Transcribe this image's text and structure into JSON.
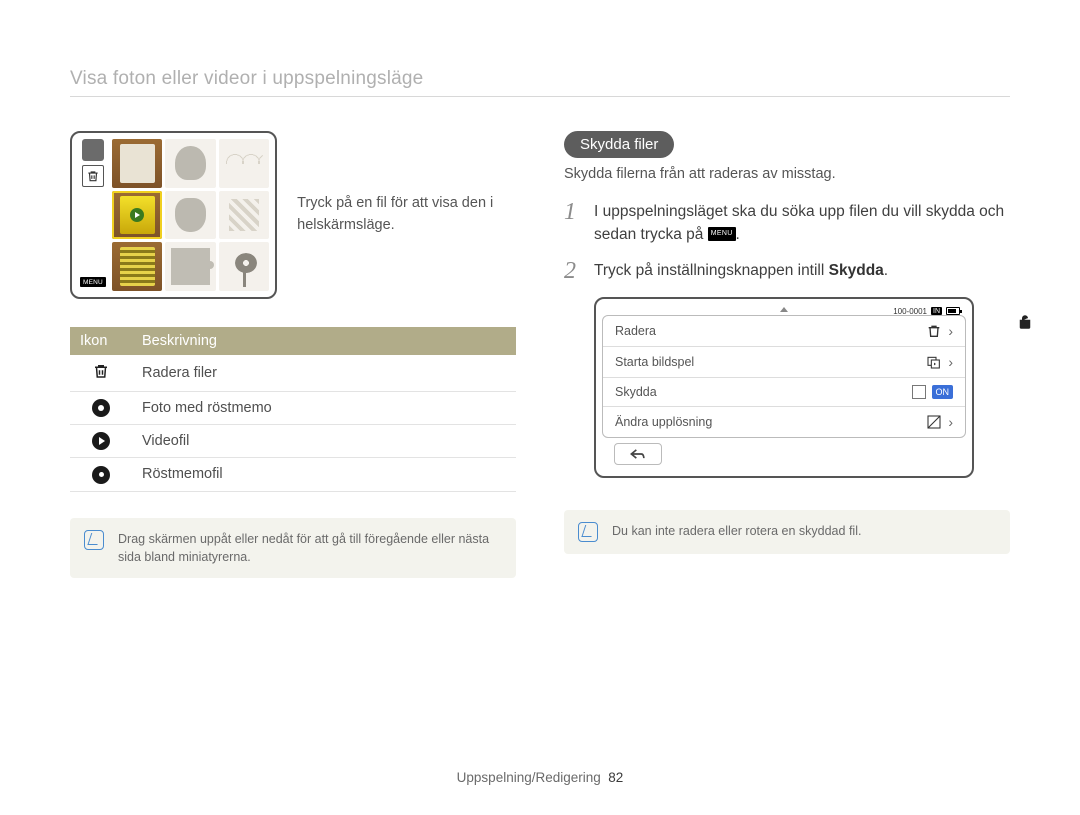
{
  "page_title": "Visa foton eller videor i uppspelningsläge",
  "left": {
    "illustration_caption": "Tryck på en fil för att visa den i helskärmsläge.",
    "menu_label": "MENU",
    "legend_headers": {
      "icon": "Ikon",
      "desc": "Beskrivning"
    },
    "legend": [
      {
        "icon": "trash-icon",
        "desc": "Radera filer"
      },
      {
        "icon": "voice-dot-icon",
        "desc": "Foto med röstmemo"
      },
      {
        "icon": "video-play-icon",
        "desc": "Videofil"
      },
      {
        "icon": "voice-memo-icon",
        "desc": "Röstmemofil"
      }
    ],
    "note": "Drag skärmen uppåt eller nedåt för att gå till föregående eller nästa sida bland miniatyrerna."
  },
  "right": {
    "section_title": "Skydda filer",
    "intro": "Skydda filerna från att raderas av misstag.",
    "steps": [
      {
        "num": "1",
        "text_before": "I uppspelningsläget ska du söka upp filen du vill skydda och sedan trycka på ",
        "chip": "MENU",
        "text_after": "."
      },
      {
        "num": "2",
        "text_before": "Tryck på inställningsknappen intill ",
        "bold": "Skydda",
        "text_after": "."
      }
    ],
    "camera_menu": {
      "status_id": "100-0001",
      "status_mem": "IN",
      "items": [
        {
          "label": "Radera",
          "icon": "trash-icon",
          "action": "chevron"
        },
        {
          "label": "Starta bildspel",
          "icon": "slideshow-icon",
          "action": "chevron"
        },
        {
          "label": "Skydda",
          "icon": null,
          "action": "on",
          "on_label": "ON"
        },
        {
          "label": "Ändra upplösning",
          "icon": "resize-icon",
          "action": "chevron"
        }
      ]
    },
    "note": "Du kan inte radera eller rotera en skyddad fil."
  },
  "footer": {
    "section": "Uppspelning/Redigering",
    "page": "82"
  }
}
